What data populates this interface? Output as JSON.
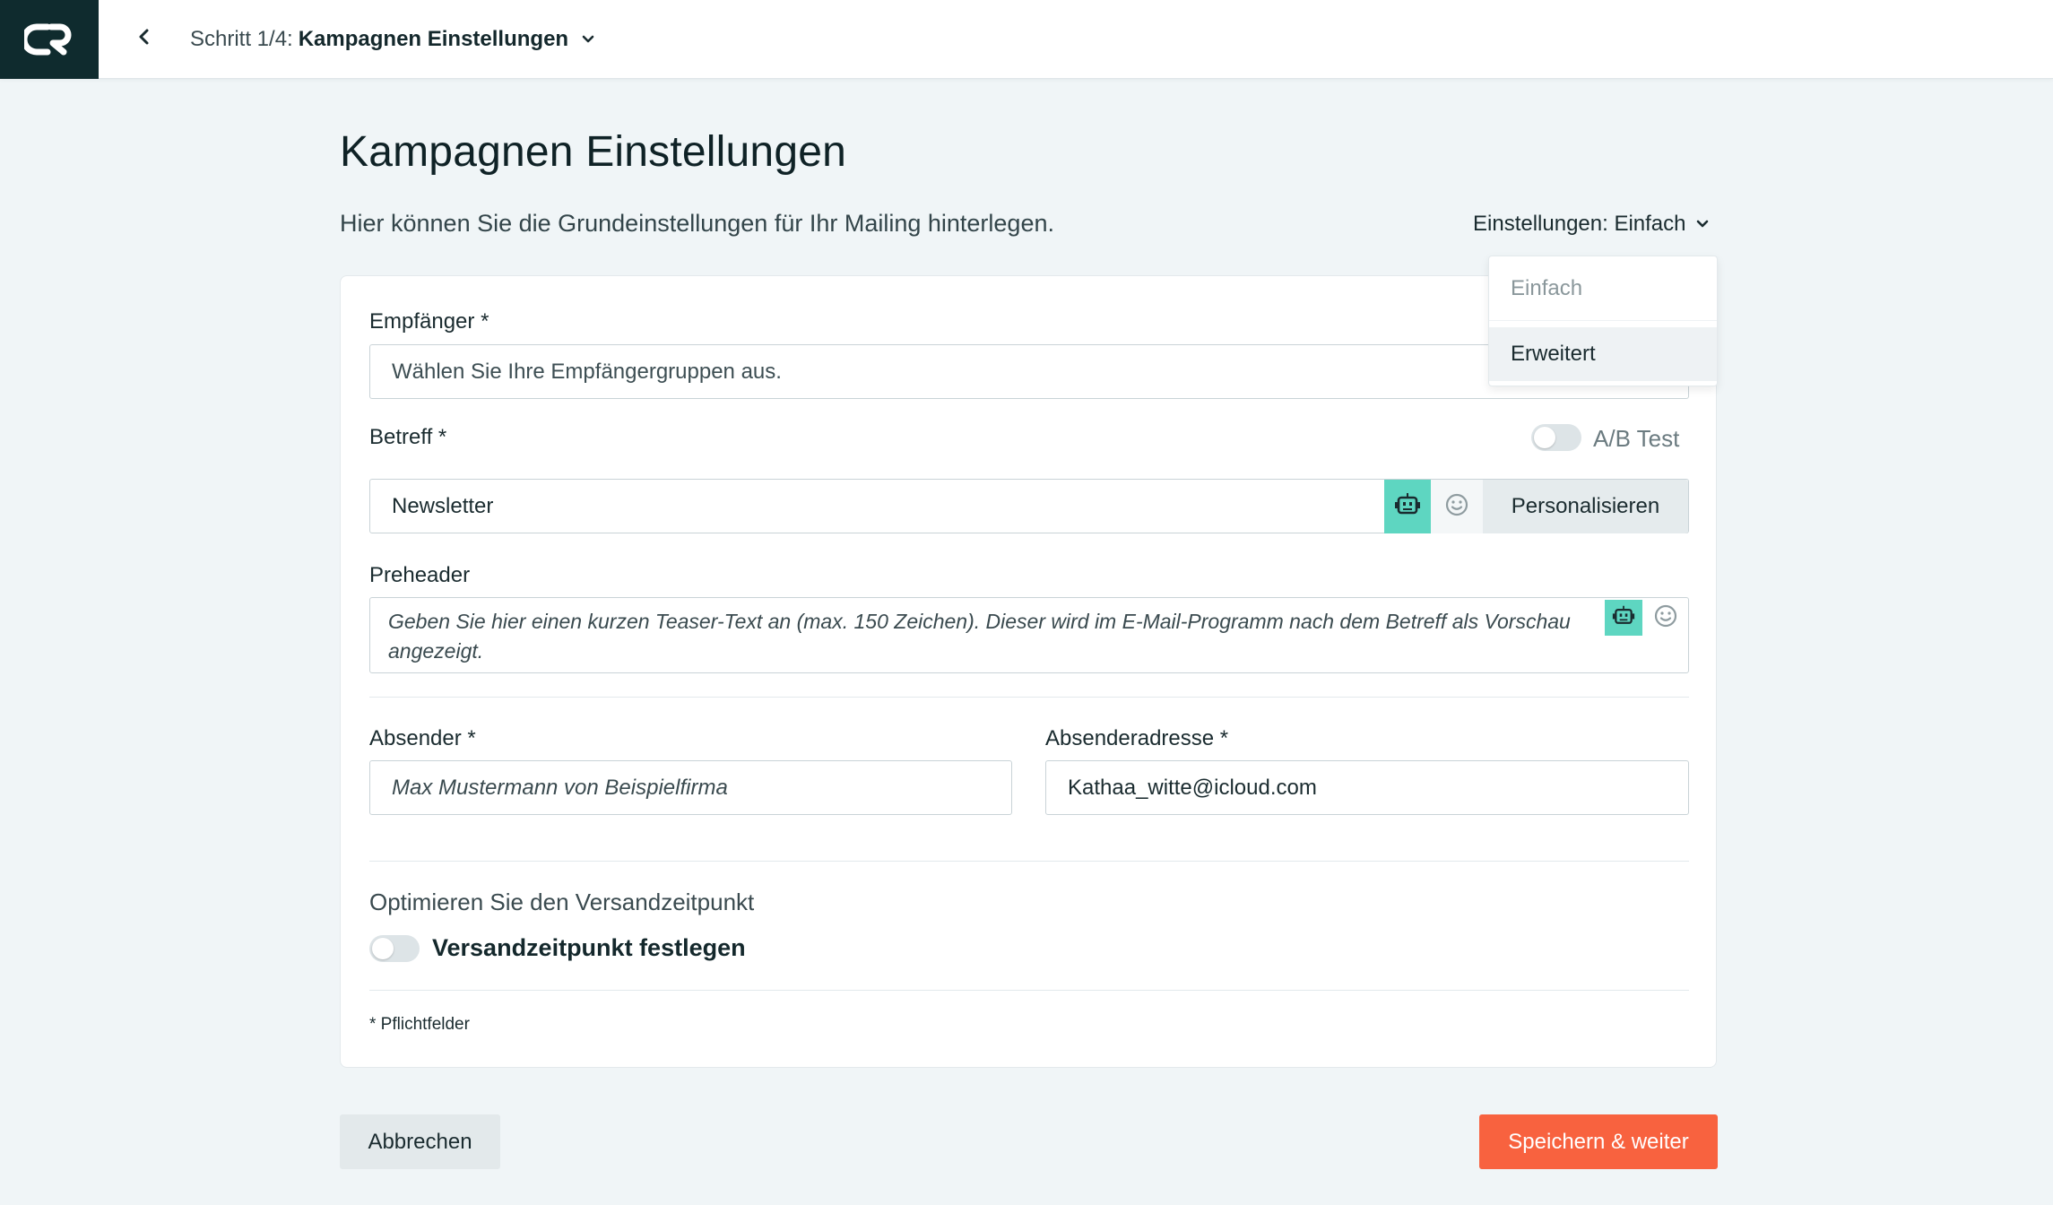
{
  "header": {
    "step_prefix": "Schritt 1/4:",
    "step_title": "Kampagnen Einstellungen"
  },
  "page": {
    "title": "Kampagnen Einstellungen",
    "subtitle": "Hier können Sie die Grundeinstellungen für Ihr Mailing hinterlegen.",
    "settings_toggle_label": "Einstellungen: Einfach"
  },
  "settings_dropdown": {
    "options": [
      "Einfach",
      "Erweitert"
    ],
    "hovered": "Erweitert"
  },
  "form": {
    "recipients": {
      "label": "Empfänger *",
      "placeholder": "Wählen Sie Ihre Empfängergruppen aus."
    },
    "subject": {
      "label": "Betreff *",
      "value": "Newsletter",
      "ab_test_label": "A/B Test",
      "ab_test_enabled": false,
      "personalize_label": "Personalisieren"
    },
    "preheader": {
      "label": "Preheader",
      "placeholder": "Geben Sie hier einen kurzen Teaser-Text an (max. 150 Zeichen). Dieser wird im E-Mail-Programm nach dem Betreff als Vorschau angezeigt."
    },
    "sender": {
      "label": "Absender *",
      "placeholder": "Max Mustermann von Beispielfirma"
    },
    "sender_address": {
      "label": "Absenderadresse *",
      "value": "Kathaa_witte@icloud.com"
    },
    "send_time": {
      "title": "Optimieren Sie den Versandzeitpunkt",
      "switch_label": "Versandzeitpunkt festlegen",
      "enabled": false
    },
    "required_note": "* Pflichtfelder"
  },
  "footer": {
    "cancel_label": "Abbrechen",
    "save_label": "Speichern & weiter"
  },
  "colors": {
    "brand_dark": "#0f2b2e",
    "ai_accent": "#5ed6c1",
    "primary_action": "#f8623f",
    "background": "#f0f5f7"
  },
  "icons": [
    "logo-icon",
    "chevron-left-icon",
    "chevron-down-icon",
    "robot-icon",
    "emoji-icon"
  ]
}
